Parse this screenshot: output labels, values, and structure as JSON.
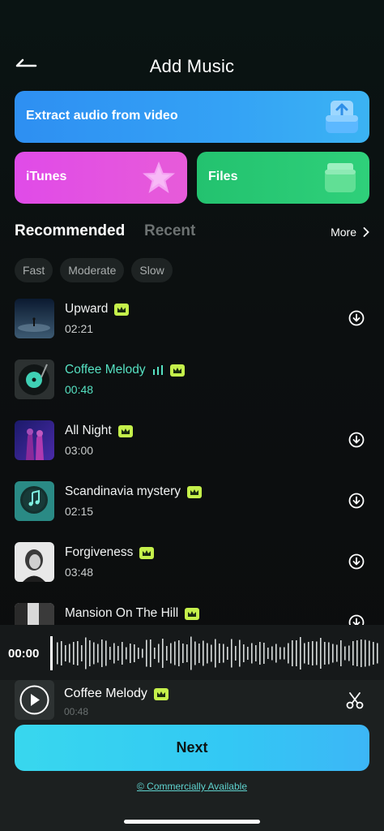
{
  "header": {
    "title": "Add Music",
    "back_icon": "arrow-left-icon"
  },
  "sources": {
    "extract": {
      "label": "Extract audio from video",
      "icon": "upload-tray-icon",
      "color": "#3399f3"
    },
    "itunes": {
      "label": "iTunes",
      "icon": "star-icon",
      "color": "#e04be8"
    },
    "files": {
      "label": "Files",
      "icon": "folder-icon",
      "color": "#27c874"
    }
  },
  "tabs": {
    "recommended": "Recommended",
    "recent": "Recent",
    "more": "More"
  },
  "filters": [
    "Fast",
    "Moderate",
    "Slow"
  ],
  "tracks": [
    {
      "name": "Upward",
      "duration": "02:21",
      "premium": true,
      "state": "download"
    },
    {
      "name": "Coffee Melody",
      "duration": "00:48",
      "premium": true,
      "state": "playing"
    },
    {
      "name": "All Night",
      "duration": "03:00",
      "premium": true,
      "state": "download"
    },
    {
      "name": "Scandinavia mystery",
      "duration": "02:15",
      "premium": true,
      "state": "download"
    },
    {
      "name": "Forgiveness",
      "duration": "03:48",
      "premium": true,
      "state": "download"
    },
    {
      "name": "Mansion On The Hill",
      "duration": "",
      "premium": true,
      "state": "download"
    }
  ],
  "player": {
    "time": "00:00",
    "track_name": "Coffee Melody",
    "track_duration": "00:48",
    "premium": true
  },
  "next_label": "Next",
  "commercial_label": "© Commercially Available",
  "colors": {
    "accent": "#56e1c2",
    "premium": "#c5f04b",
    "next_button": "#36cff0"
  }
}
